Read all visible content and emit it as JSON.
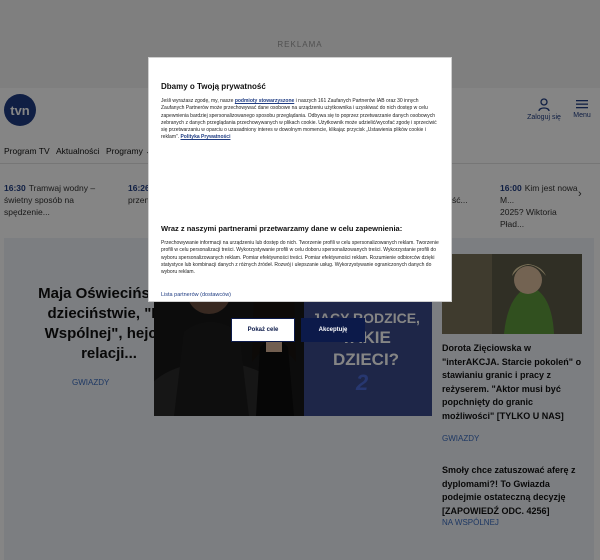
{
  "ad": {
    "label": "REKLAMA"
  },
  "header": {
    "logo_text": "tvn",
    "login_label": "Zaloguj się",
    "menu_label": "Menu"
  },
  "nav": {
    "items": [
      "Program TV",
      "Aktualności",
      "Programy"
    ]
  },
  "ticker": {
    "items": [
      {
        "time": "16:30",
        "text_line1": "Tramwaj wodny –",
        "text_line2": "świetny sposób na spędzenie..."
      },
      {
        "time": "16:26",
        "text_line1": "",
        "text_line2": "przen..."
      },
      {
        "time": "",
        "text_line1": "",
        "text_line2": "ść..."
      },
      {
        "time": "16:00",
        "text_line1": "Kim jest nowa M...",
        "text_line2": "2025? Wiktoria Pład..."
      }
    ]
  },
  "feature": {
    "title": "Maja Oświecińska o dzieciństwie, \"Na Wspólnej\", hejcie, relacji...",
    "tag": "GWIAZDY",
    "image_caption_line1": "JACY RODZICE,",
    "image_caption_line2": "TAKIE DZIECI?",
    "image_caption_num": "2"
  },
  "side": {
    "title1": "Dorota Zięciowska w \"interAKCJA. Starcie pokoleń\" o stawianiu granic i pracy z reżyserem. \"Aktor musi być popchnięty do granic możliwości\" [TYLKO U NAS]",
    "tag1": "GWIAZDY",
    "title2": "Smoły chce zatuszować aferę z dyplomami?! To Gwiazda podejmie ostateczną decyzję [ZAPOWIEDŹ ODC. 4256]",
    "tag2": "NA WSPÓLNEJ"
  },
  "modal": {
    "title": "Dbamy o Twoją prywatność",
    "p1_a": "Jeśli wyrażasz zgodę, my, nasze ",
    "p1_link": "podmioty stowarzyszone",
    "p1_b": " i naszych 161 Zaufanych Partnerów IAB oraz 30 innych Zaufanych Partnerów może przechowywać dane osobowe na urządzeniu użytkownika i uzyskiwać do nich dostęp w celu zapewnienia bardziej spersonalizowanego sposobu przeglądania. Odbywa się to poprzez przetwarzanie danych osobowych zebranych z danych przeglądania przechowywanych w plikach cookie. Użytkownik może udzielić/wycofać zgodę i sprzeciwić się przetwarzaniu w oparciu o uzasadniony interes w dowolnym momencie, klikając przycisk „Ustawienia plików cookie i reklam”. ",
    "p1_link2": "Polityka Prywatności",
    "h2": "Wraz z naszymi partnerami przetwarzamy dane w celu zapewnienia:",
    "p2": "Przechowywanie informacji na urządzeniu lub dostęp do nich. Tworzenie profili w celu spersonalizowanych reklam. Tworzenie profili w celu personalizacji treści. Wykorzystywanie profili w celu doboru spersonalizowanych treści. Wykorzystanie profili do wyboru spersonalizowanych reklam. Pomiar efektywności treści. Pomiar efektywności reklam. Rozumienie odbiorców dzięki statystyce lub kombinacji danych z różnych źródeł. Rozwój i ulepszanie usług. Wykorzystywanie ograniczonych danych do wyboru reklam.",
    "vendors_link": "Lista partnerów (dostawców)",
    "btn_details": "Pokaż cele",
    "btn_accept": "Akceptuję"
  },
  "colors": {
    "brand": "#1f3c82",
    "accept_button": "#0c1a4a",
    "overlay": "rgba(0,0,0,0.48)"
  }
}
